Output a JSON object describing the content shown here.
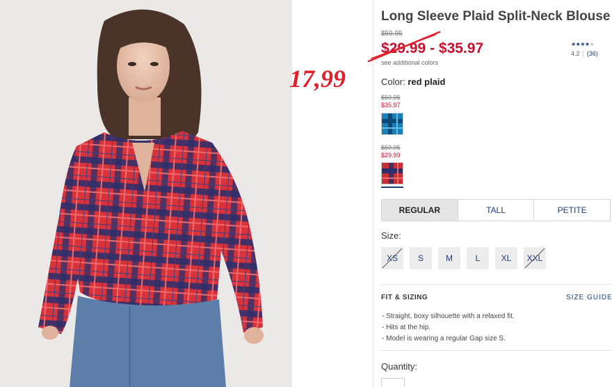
{
  "product": {
    "title": "Long Sleeve Plaid Split-Neck Blouse",
    "original_price": "$59.95",
    "price_range": "$29.99 - $35.97",
    "see_colors": "see additional colors",
    "rating": {
      "stars": 4,
      "out_of": 5,
      "value": "4.2",
      "separator": "|",
      "count": "(36)"
    }
  },
  "annotation": {
    "price": "17,99",
    "color": "#e0202c"
  },
  "color": {
    "label": "Color:",
    "selected": "red plaid",
    "swatches": [
      {
        "name": "blue plaid",
        "original_price": "$59.95",
        "sale_price": "$35.97",
        "selected": false
      },
      {
        "name": "red plaid",
        "original_price": "$59.95",
        "sale_price": "$29.99",
        "selected": true
      }
    ]
  },
  "fit_tabs": [
    {
      "label": "REGULAR",
      "active": true
    },
    {
      "label": "TALL",
      "active": false
    },
    {
      "label": "PETITE",
      "active": false
    }
  ],
  "sizes": {
    "label": "Size:",
    "options": [
      {
        "label": "XS",
        "available": false
      },
      {
        "label": "S",
        "available": true
      },
      {
        "label": "M",
        "available": true
      },
      {
        "label": "L",
        "available": true
      },
      {
        "label": "XL",
        "available": true
      },
      {
        "label": "XXL",
        "available": false
      }
    ]
  },
  "fit_sizing": {
    "heading": "FIT & SIZING",
    "guide_link": "SIZE GUIDE",
    "details": [
      "- Straight, boxy silhouette with a relaxed fit.",
      "- Hits at the hip.",
      "- Model is wearing a regular Gap size S."
    ]
  },
  "quantity": {
    "label": "Quantity:"
  },
  "colors": {
    "sale": "#c8102e",
    "link": "#1f3e7c",
    "tab_active_bg": "#e5e5e5"
  }
}
